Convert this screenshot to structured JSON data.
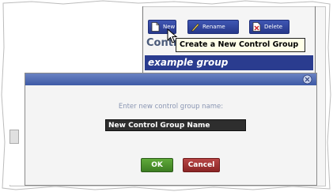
{
  "toolbar": {
    "new_label": "New",
    "rename_label": "Rename",
    "delete_label": "Delete"
  },
  "tooltip": {
    "text": "Create a New Control Group"
  },
  "section": {
    "title": "Contr"
  },
  "list": {
    "items": [
      "example group"
    ]
  },
  "dialog": {
    "prompt": "Enter new control group name:",
    "input_value": "New Control Group Name",
    "ok_label": "OK",
    "cancel_label": "Cancel"
  },
  "colors": {
    "toolbar_button": "#2a3c8f",
    "selected_item": "#2a3c8f",
    "titlebar": "#4f6bb3",
    "ok_button": "#4e9a2e",
    "cancel_button": "#a33434"
  }
}
